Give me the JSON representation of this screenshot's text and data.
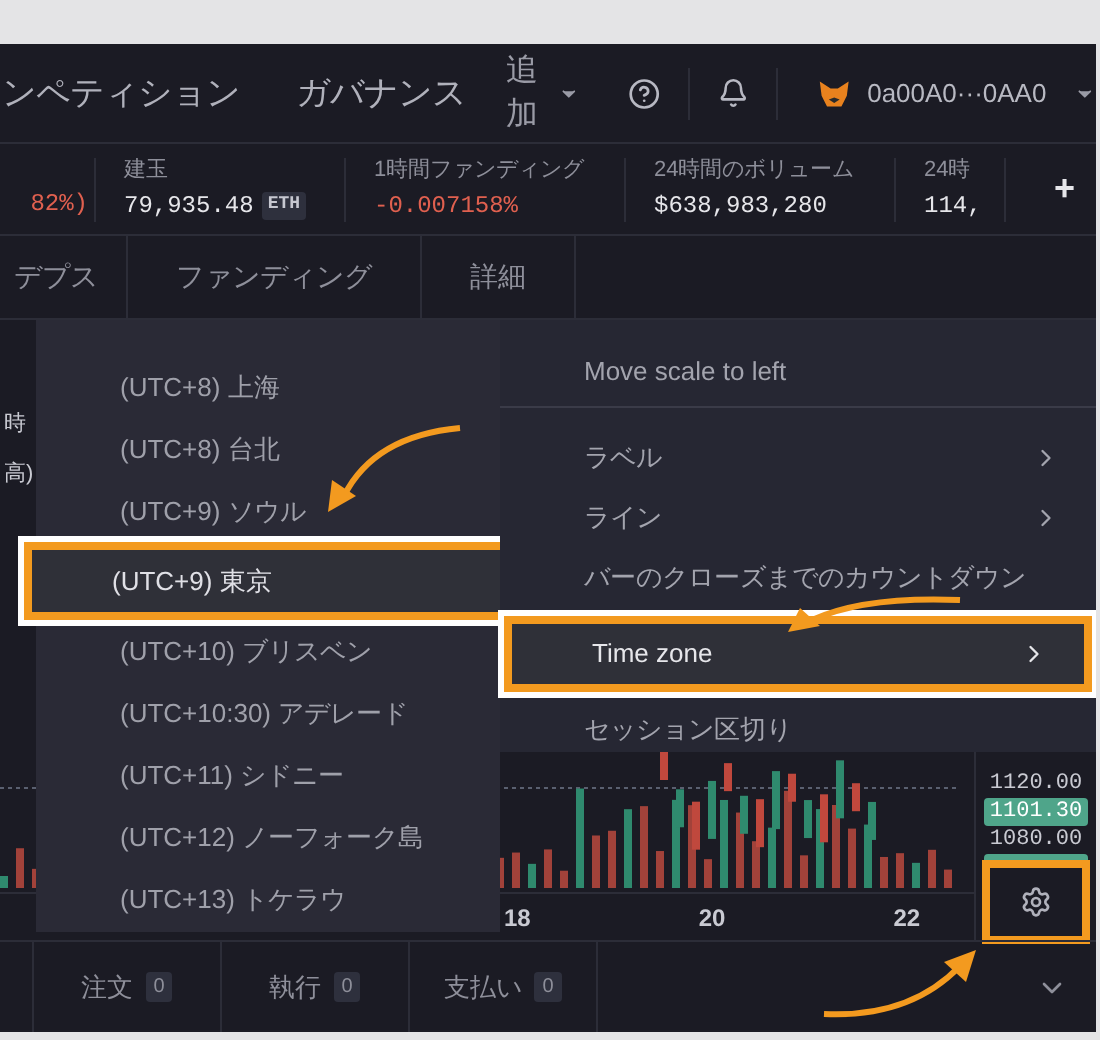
{
  "nav": {
    "items": [
      "ンペティション",
      "ガバナンス"
    ],
    "more": "追加",
    "wallet": "0a00A0···0AA0"
  },
  "stats": [
    {
      "value": "82%)",
      "negative": true
    },
    {
      "label": "建玉",
      "value": "79,935.48",
      "unit": "ETH",
      "negative": false
    },
    {
      "label": "1時間ファンディング",
      "value": "-0.007158%",
      "negative": true
    },
    {
      "label": "24時間のボリューム",
      "value": "$638,983,280",
      "negative": false
    },
    {
      "label": "24時",
      "value": "114,",
      "negative": false
    }
  ],
  "add_button": "+",
  "tabs": [
    {
      "label": "デプス",
      "selected": false
    },
    {
      "label": "ファンディング",
      "selected": false
    },
    {
      "label": "詳細",
      "selected": false
    }
  ],
  "chart_legend": [
    "時",
    "高)"
  ],
  "timezone_menu": [
    {
      "label": "(UTC+8) 上海",
      "selected": false
    },
    {
      "label": "(UTC+8) 台北",
      "selected": false
    },
    {
      "label": "(UTC+9) ソウル",
      "selected": false
    },
    {
      "label": "(UTC+9) 東京",
      "selected": true
    },
    {
      "label": "(UTC+10) ブリスベン",
      "selected": false
    },
    {
      "label": "(UTC+10:30) アデレード",
      "selected": false
    },
    {
      "label": "(UTC+11) シドニー",
      "selected": false
    },
    {
      "label": "(UTC+12) ノーフォーク島",
      "selected": false
    },
    {
      "label": "(UTC+13) トケラウ",
      "selected": false
    }
  ],
  "settings_menu": [
    {
      "label": "Move scale to left",
      "submenu": false,
      "selected": false,
      "divider_after": true
    },
    {
      "label": "ラベル",
      "submenu": true,
      "selected": false,
      "divider_after": false
    },
    {
      "label": "ライン",
      "submenu": true,
      "selected": false,
      "divider_after": false
    },
    {
      "label": "バーのクローズまでのカウントダウン",
      "submenu": false,
      "selected": false,
      "divider_after": false
    },
    {
      "label": "Time zone",
      "submenu": true,
      "selected": true,
      "divider_after": false
    },
    {
      "label": "セッション区切り",
      "submenu": false,
      "selected": false,
      "divider_after": false
    }
  ],
  "price_axis": [
    {
      "label": "1120.00",
      "kind": "tick"
    },
    {
      "label": "1101.30",
      "kind": "current"
    },
    {
      "label": "1080.00",
      "kind": "tick"
    }
  ],
  "time_axis": [
    "18",
    "20",
    "22"
  ],
  "bottom_tabs": [
    {
      "label": "注文",
      "count": "0"
    },
    {
      "label": "執行",
      "count": "0"
    },
    {
      "label": "支払い",
      "count": "0"
    }
  ]
}
